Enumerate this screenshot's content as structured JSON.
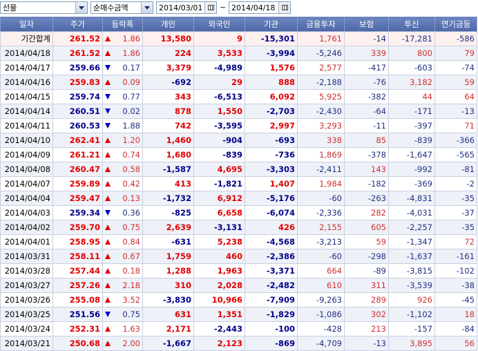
{
  "toolbar": {
    "market": "선물",
    "metric": "순매수금액",
    "date_from": "2014/03/01",
    "date_to": "2014/04/18",
    "range_sep": "~"
  },
  "columns": [
    "일자",
    "주가",
    "등락폭",
    "개인",
    "외국인",
    "기관",
    "금융투자",
    "보험",
    "투신",
    "연기금등"
  ],
  "colors": {
    "up": "#e00000",
    "down": "#00008b",
    "header": "#5a73b2"
  },
  "rows": [
    {
      "date": "기간합계",
      "price": "261.52",
      "dir": "up",
      "change": "1.86",
      "indiv": "13,580",
      "foreign": "9",
      "inst": "-15,301",
      "fin": "1,761",
      "ins": "-14",
      "trust": "-17,281",
      "pension": "-586"
    },
    {
      "date": "2014/04/18",
      "price": "261.52",
      "dir": "up",
      "change": "1.86",
      "indiv": "224",
      "foreign": "3,533",
      "inst": "-3,994",
      "fin": "-5,246",
      "ins": "339",
      "trust": "800",
      "pension": "79"
    },
    {
      "date": "2014/04/17",
      "price": "259.66",
      "dir": "down",
      "change": "0.17",
      "indiv": "3,379",
      "foreign": "-4,989",
      "inst": "1,576",
      "fin": "2,577",
      "ins": "-417",
      "trust": "-603",
      "pension": "-74"
    },
    {
      "date": "2014/04/16",
      "price": "259.83",
      "dir": "up",
      "change": "0.09",
      "indiv": "-692",
      "foreign": "29",
      "inst": "888",
      "fin": "-2,188",
      "ins": "-76",
      "trust": "3,182",
      "pension": "59"
    },
    {
      "date": "2014/04/15",
      "price": "259.74",
      "dir": "down",
      "change": "0.77",
      "indiv": "343",
      "foreign": "-6,513",
      "inst": "6,092",
      "fin": "5,925",
      "ins": "-382",
      "trust": "44",
      "pension": "64"
    },
    {
      "date": "2014/04/14",
      "price": "260.51",
      "dir": "down",
      "change": "0.02",
      "indiv": "878",
      "foreign": "1,550",
      "inst": "-2,703",
      "fin": "-2,430",
      "ins": "-64",
      "trust": "-171",
      "pension": "-13"
    },
    {
      "date": "2014/04/11",
      "price": "260.53",
      "dir": "down",
      "change": "1.88",
      "indiv": "742",
      "foreign": "-3,595",
      "inst": "2,997",
      "fin": "3,293",
      "ins": "-11",
      "trust": "-397",
      "pension": "71"
    },
    {
      "date": "2014/04/10",
      "price": "262.41",
      "dir": "up",
      "change": "1.20",
      "indiv": "1,460",
      "foreign": "-904",
      "inst": "-693",
      "fin": "338",
      "ins": "85",
      "trust": "-839",
      "pension": "-366"
    },
    {
      "date": "2014/04/09",
      "price": "261.21",
      "dir": "up",
      "change": "0.74",
      "indiv": "1,680",
      "foreign": "-839",
      "inst": "-736",
      "fin": "1,869",
      "ins": "-378",
      "trust": "-1,647",
      "pension": "-565"
    },
    {
      "date": "2014/04/08",
      "price": "260.47",
      "dir": "up",
      "change": "0.58",
      "indiv": "-1,587",
      "foreign": "4,695",
      "inst": "-3,303",
      "fin": "-2,411",
      "ins": "143",
      "trust": "-992",
      "pension": "-81"
    },
    {
      "date": "2014/04/07",
      "price": "259.89",
      "dir": "up",
      "change": "0.42",
      "indiv": "413",
      "foreign": "-1,821",
      "inst": "1,407",
      "fin": "1,984",
      "ins": "-182",
      "trust": "-369",
      "pension": "-2"
    },
    {
      "date": "2014/04/04",
      "price": "259.47",
      "dir": "up",
      "change": "0.13",
      "indiv": "-1,732",
      "foreign": "6,912",
      "inst": "-5,176",
      "fin": "-60",
      "ins": "-263",
      "trust": "-4,831",
      "pension": "-35"
    },
    {
      "date": "2014/04/03",
      "price": "259.34",
      "dir": "down",
      "change": "0.36",
      "indiv": "-825",
      "foreign": "6,658",
      "inst": "-6,074",
      "fin": "-2,336",
      "ins": "282",
      "trust": "-4,031",
      "pension": "-37"
    },
    {
      "date": "2014/04/02",
      "price": "259.70",
      "dir": "up",
      "change": "0.75",
      "indiv": "2,639",
      "foreign": "-3,131",
      "inst": "426",
      "fin": "2,155",
      "ins": "605",
      "trust": "-2,257",
      "pension": "-35"
    },
    {
      "date": "2014/04/01",
      "price": "258.95",
      "dir": "up",
      "change": "0.84",
      "indiv": "-631",
      "foreign": "5,238",
      "inst": "-4,568",
      "fin": "-3,213",
      "ins": "59",
      "trust": "-1,347",
      "pension": "72"
    },
    {
      "date": "2014/03/31",
      "price": "258.11",
      "dir": "up",
      "change": "0.67",
      "indiv": "1,759",
      "foreign": "460",
      "inst": "-2,386",
      "fin": "-60",
      "ins": "-298",
      "trust": "-1,637",
      "pension": "-161"
    },
    {
      "date": "2014/03/28",
      "price": "257.44",
      "dir": "up",
      "change": "0.18",
      "indiv": "1,288",
      "foreign": "1,963",
      "inst": "-3,371",
      "fin": "664",
      "ins": "-89",
      "trust": "-3,815",
      "pension": "-102"
    },
    {
      "date": "2014/03/27",
      "price": "257.26",
      "dir": "up",
      "change": "2.18",
      "indiv": "310",
      "foreign": "2,028",
      "inst": "-2,482",
      "fin": "610",
      "ins": "311",
      "trust": "-3,539",
      "pension": "-38"
    },
    {
      "date": "2014/03/26",
      "price": "255.08",
      "dir": "up",
      "change": "3.52",
      "indiv": "-3,830",
      "foreign": "10,966",
      "inst": "-7,909",
      "fin": "-9,263",
      "ins": "289",
      "trust": "926",
      "pension": "-45"
    },
    {
      "date": "2014/03/25",
      "price": "251.56",
      "dir": "down",
      "change": "0.75",
      "indiv": "631",
      "foreign": "1,351",
      "inst": "-1,829",
      "fin": "-1,086",
      "ins": "302",
      "trust": "-1,102",
      "pension": "18"
    },
    {
      "date": "2014/03/24",
      "price": "252.31",
      "dir": "up",
      "change": "1.63",
      "indiv": "2,171",
      "foreign": "-2,443",
      "inst": "-100",
      "fin": "-428",
      "ins": "213",
      "trust": "-157",
      "pension": "-84"
    },
    {
      "date": "2014/03/21",
      "price": "250.68",
      "dir": "up",
      "change": "2.00",
      "indiv": "-1,667",
      "foreign": "2,123",
      "inst": "-869",
      "fin": "-4,709",
      "ins": "-13",
      "trust": "3,895",
      "pension": "56"
    }
  ]
}
